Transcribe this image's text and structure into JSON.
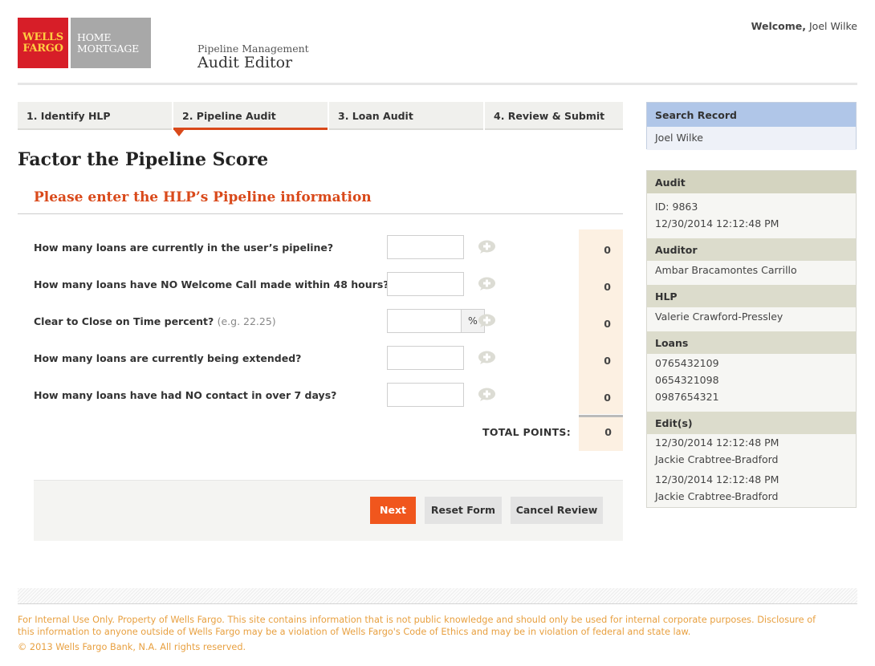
{
  "header": {
    "logo_line1": "WELLS",
    "logo_line2": "FARGO",
    "logo_home": "HOME",
    "logo_mortgage": "MORTGAGE",
    "app_subtitle": "Pipeline Management",
    "app_title": "Audit Editor",
    "welcome_label": "Welcome,",
    "welcome_user": "Joel Wilke"
  },
  "tabs": [
    {
      "label": "1. Identify HLP",
      "active": false
    },
    {
      "label": "2. Pipeline Audit",
      "active": true
    },
    {
      "label": "3. Loan Audit",
      "active": false
    },
    {
      "label": "4. Review & Submit",
      "active": false
    }
  ],
  "main": {
    "page_title": "Factor the Pipeline Score",
    "section_heading": "Please enter the HLP’s Pipeline information",
    "questions": [
      {
        "label": "How many loans are currently in the user’s pipeline?",
        "hint": "",
        "value": "",
        "score": "0"
      },
      {
        "label": "How many loans have NO Welcome Call made within 48 hours?",
        "hint": "",
        "value": "",
        "score": "0"
      },
      {
        "label": "Clear to Close on Time percent?",
        "hint": "(e.g. 22.25)",
        "value": "",
        "unit": "%",
        "score": "0"
      },
      {
        "label": "How many loans are currently being extended?",
        "hint": "",
        "value": "",
        "score": "0"
      },
      {
        "label": "How many loans have had NO contact in over 7 days?",
        "hint": "",
        "value": "",
        "score": "0"
      }
    ],
    "total_label": "TOTAL POINTS:",
    "total_value": "0"
  },
  "buttons": {
    "next": "Next",
    "reset": "Reset Form",
    "cancel": "Cancel Review"
  },
  "sidebar": {
    "search_heading": "Search Record",
    "search_value": "Joel Wilke",
    "audit_heading": "Audit",
    "audit_id": "ID: 9863",
    "audit_date": "12/30/2014 12:12:48 PM",
    "auditor_heading": "Auditor",
    "auditor_name": "Ambar Bracamontes Carrillo",
    "hlp_heading": "HLP",
    "hlp_name": "Valerie Crawford-Pressley",
    "loans_heading": "Loans",
    "loans": [
      "0765432109",
      "0654321098",
      "0987654321"
    ],
    "edits_heading": "Edit(s)",
    "edits": [
      {
        "date": "12/30/2014 12:12:48 PM",
        "name": "Jackie Crabtree-Bradford"
      },
      {
        "date": "12/30/2014 12:12:48 PM",
        "name": "Jackie Crabtree-Bradford"
      }
    ]
  },
  "footer": {
    "disclaimer_line1": "For Internal Use Only. Property of Wells Fargo. This site contains information that is not public knowledge and should only be used for internal corporate purposes. Disclosure of",
    "disclaimer_line2": "this information to anyone outside of Wells Fargo may be a violation of Wells Fargo's Code of Ethics and may be in violation of federal and state law.",
    "copyright": "© 2013 Wells Fargo Bank, N.A. All rights reserved."
  },
  "colors": {
    "brand_red": "#d71e28",
    "brand_gold": "#ffcd41",
    "accent_orange": "#d9491a",
    "button_orange": "#f0561d",
    "footer_text": "#e8a040"
  },
  "icons": {
    "question_help": "plus-bubble-icon"
  }
}
